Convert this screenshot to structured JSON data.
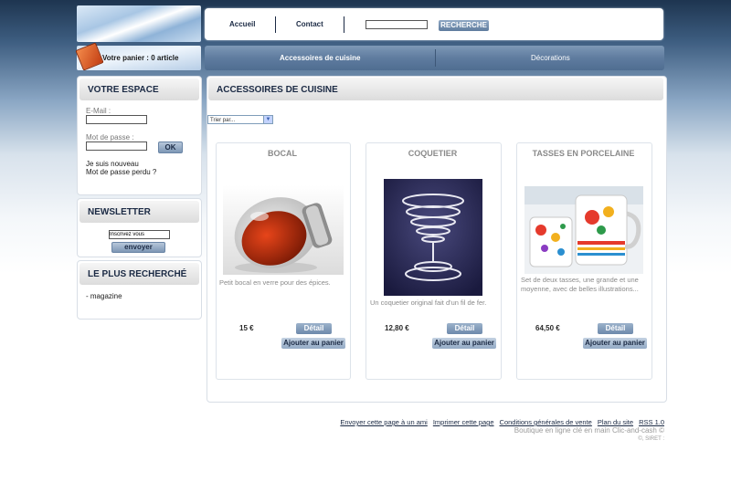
{
  "header": {
    "cart_text": "Votre panier : 0 article",
    "nav": [
      "Accueil",
      "Contact"
    ],
    "search_button": "RECHERCHE",
    "categories": [
      "Accessoires de cuisine",
      "Décorations"
    ]
  },
  "sidebar": {
    "votre_espace": {
      "title": "VOTRE ESPACE",
      "email_label": "E-Mail :",
      "password_label": "Mot de passe :",
      "ok_button": "OK",
      "new_user": "Je suis nouveau",
      "lost_password": "Mot de passe perdu ?"
    },
    "newsletter": {
      "title": "NEWSLETTER",
      "input_value": "Inscrivez vous",
      "send_button": "envoyer"
    },
    "most_searched": {
      "title": "LE PLUS RECHERCHÉ",
      "items": [
        "- magazine"
      ]
    }
  },
  "main": {
    "title": "ACCESSOIRES DE CUISINE",
    "sort_label": "Trier par...",
    "products": [
      {
        "name": "BOCAL",
        "description": "Petit bocal en verre pour des épices.",
        "price": "15 €",
        "detail_button": "Détail",
        "add_button": "Ajouter au panier"
      },
      {
        "name": "COQUETIER",
        "description": "Un coquetier original fait d'un fil de fer.",
        "price": "12,80 €",
        "detail_button": "Détail",
        "add_button": "Ajouter au panier"
      },
      {
        "name": "TASSES EN PORCELAINE",
        "description": "Set de deux tasses, une grande et une moyenne, avec de belles illustrations...",
        "price": "64,50 €",
        "detail_button": "Détail",
        "add_button": "Ajouter au panier"
      }
    ]
  },
  "footer": {
    "links": [
      "Envoyer cette page à un ami",
      "Imprimer cette page",
      "Conditions générales de vente",
      "Plan du site",
      "RSS 1.0"
    ],
    "credit": "Boutique en ligne clé en main Clic-and-cash ©",
    "siret": "©, SIRET :"
  },
  "colors": {
    "accent": "#5f7c9f",
    "title_text": "#1b2a44"
  }
}
